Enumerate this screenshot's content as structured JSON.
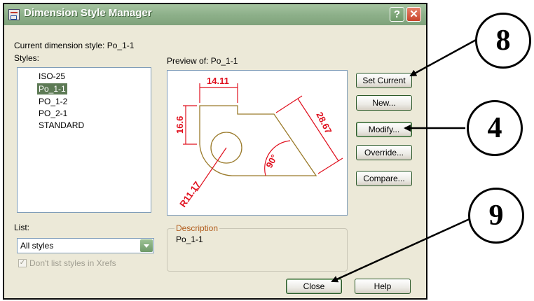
{
  "window": {
    "title": "Dimension Style Manager",
    "help_glyph": "?",
    "close_glyph": "✕"
  },
  "current_style_text": "Current dimension style: Po_1-1",
  "styles": {
    "label": "Styles:",
    "items": [
      {
        "label": "ISO-25"
      },
      {
        "label": "Po_1-1"
      },
      {
        "label": "PO_1-2"
      },
      {
        "label": "PO_2-1"
      },
      {
        "label": "STANDARD"
      }
    ],
    "selected": "Po_1-1"
  },
  "preview": {
    "label": "Preview of: Po_1-1",
    "dims": {
      "top": "14.11",
      "left": "16.6",
      "right": "28.67",
      "angle": "90°",
      "radius": "R11.17"
    }
  },
  "description": {
    "legend": "Description",
    "text": "Po_1-1"
  },
  "list": {
    "label": "List:",
    "value": "All styles",
    "checkbox_label": "Don't list styles in Xrefs"
  },
  "buttons": {
    "set_current": "Set Current",
    "new": "New...",
    "modify": "Modify...",
    "override": "Override...",
    "compare": "Compare...",
    "close": "Close",
    "help": "Help"
  },
  "callouts": {
    "c1": "8",
    "c2": "4",
    "c3": "9"
  },
  "colors": {
    "titlebar": "#8db08a",
    "dimension": "#e0101e",
    "geometry": "#9a7a2a",
    "selection": "#5d7a55"
  }
}
